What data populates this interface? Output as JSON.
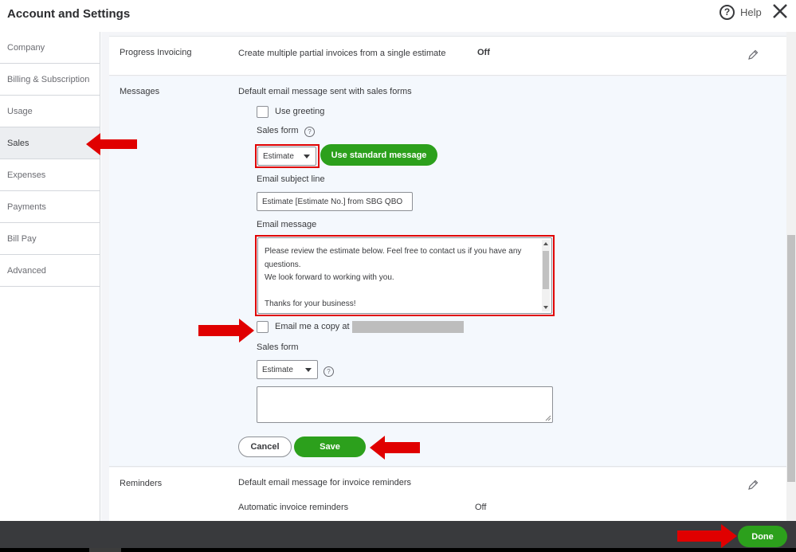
{
  "header": {
    "title": "Account and Settings",
    "help_label": "Help"
  },
  "sidebar": {
    "items": [
      {
        "label": "Company"
      },
      {
        "label": "Billing & Subscription"
      },
      {
        "label": "Usage"
      },
      {
        "label": "Sales"
      },
      {
        "label": "Expenses"
      },
      {
        "label": "Payments"
      },
      {
        "label": "Bill Pay"
      },
      {
        "label": "Advanced"
      }
    ],
    "active": "Sales"
  },
  "progress_invoicing": {
    "label": "Progress Invoicing",
    "description": "Create multiple partial invoices from a single estimate",
    "status": "Off"
  },
  "messages": {
    "label": "Messages",
    "description": "Default email message sent with sales forms",
    "use_greeting_label": "Use greeting",
    "use_greeting_checked": false,
    "sales_form_label": "Sales form",
    "sales_form_value": "Estimate",
    "use_standard_label": "Use standard message",
    "subject_label": "Email subject line",
    "subject_value": "Estimate [Estimate No.] from SBG QBO",
    "email_message_label": "Email message",
    "email_message_value": "Please review the estimate below.  Feel free to contact us if you have any questions.\nWe look forward to working with you.\n\nThanks for your business!\nSBG QBO Test User",
    "email_copy_label": "Email me a copy at",
    "email_copy_checked": false,
    "sales_form2_label": "Sales form",
    "sales_form2_value": "Estimate",
    "cancel_label": "Cancel",
    "save_label": "Save"
  },
  "reminders": {
    "label": "Reminders",
    "description": "Default email message for invoice reminders",
    "auto_label": "Automatic invoice reminders",
    "auto_status": "Off"
  },
  "footer": {
    "done_label": "Done"
  },
  "colors": {
    "green": "#2ca01c",
    "highlight_red": "#e00000",
    "footer_bg": "#393a3d"
  }
}
